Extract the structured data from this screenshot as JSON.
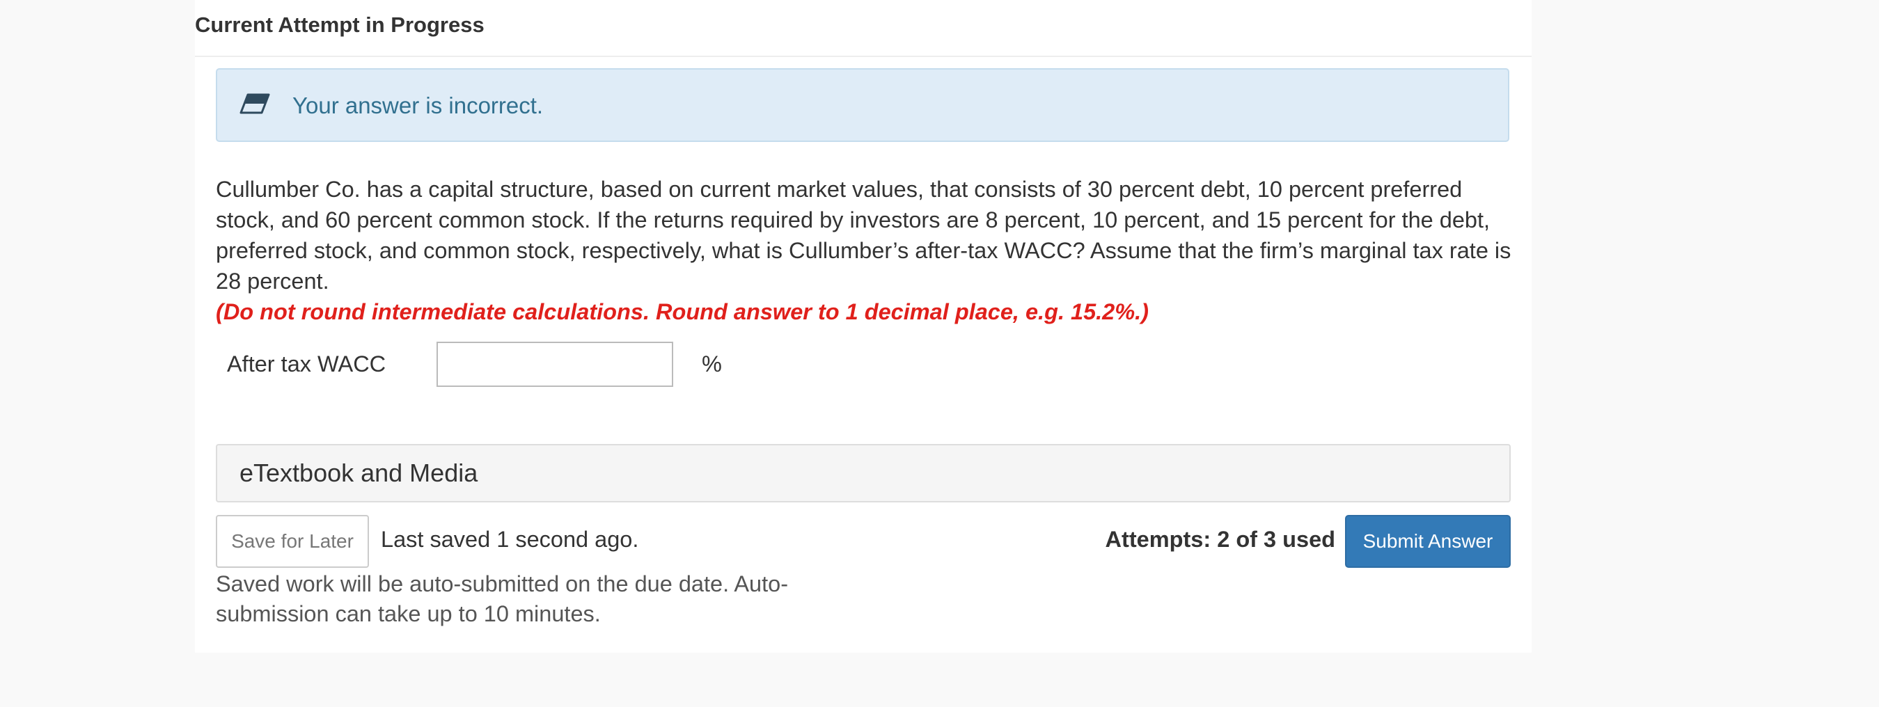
{
  "header": {
    "title": "Current Attempt in Progress"
  },
  "feedback": {
    "icon": "eraser-icon",
    "message": "Your answer is incorrect.",
    "background_color": "#dfecf7",
    "text_color": "#31708f"
  },
  "question": {
    "text": "Cullumber Co. has a capital structure, based on current market values, that consists of 30 percent debt, 10 percent preferred stock, and 60 percent common stock. If the returns required by investors are 8 percent, 10 percent, and 15 percent for the debt, preferred stock, and common stock, respectively, what is Cullumber’s after-tax WACC? Assume that the firm’s marginal tax rate is 28 percent.",
    "instruction": "(Do not round intermediate calculations. Round answer to 1 decimal place, e.g. 15.2%.)",
    "instruction_color": "#e0201b"
  },
  "answer": {
    "label": "After tax WACC",
    "value": "",
    "unit": "%"
  },
  "etextbook": {
    "label": "eTextbook and Media"
  },
  "footer": {
    "save_label": "Save for Later",
    "last_saved": "Last saved 1 second ago.",
    "autosubmit_note": "Saved work will be auto-submitted on the due date. Auto-submission can take up to 10 minutes.",
    "attempts": "Attempts: 2 of 3 used",
    "submit_label": "Submit Answer",
    "submit_color": "#337ab7"
  }
}
